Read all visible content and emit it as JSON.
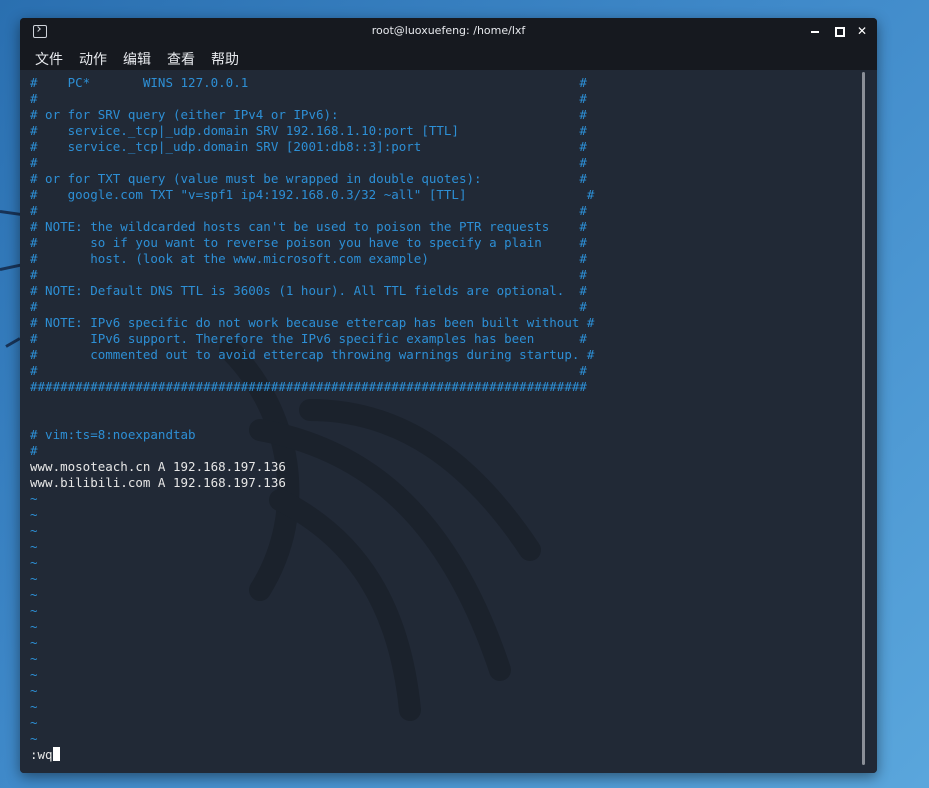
{
  "window": {
    "title": "root@luoxuefeng: /home/lxf",
    "close_glyph": "✕"
  },
  "menu": [
    "文件",
    "动作",
    "编辑",
    "查看",
    "帮助"
  ],
  "editor": {
    "lines": [
      {
        "text": "#    PC*       WINS 127.0.0.1                                            #",
        "style": "comment"
      },
      {
        "text": "#                                                                        #",
        "style": "comment"
      },
      {
        "text": "# or for SRV query (either IPv4 or IPv6):                                #",
        "style": "comment"
      },
      {
        "text": "#    service._tcp|_udp.domain SRV 192.168.1.10:port [TTL]                #",
        "style": "comment"
      },
      {
        "text": "#    service._tcp|_udp.domain SRV [2001:db8::3]:port                     #",
        "style": "comment"
      },
      {
        "text": "#                                                                        #",
        "style": "comment"
      },
      {
        "text": "# or for TXT query (value must be wrapped in double quotes):             #",
        "style": "comment"
      },
      {
        "text": "#    google.com TXT \"v=spf1 ip4:192.168.0.3/32 ~all\" [TTL]                #",
        "style": "comment"
      },
      {
        "text": "#                                                                        #",
        "style": "comment"
      },
      {
        "text": "# NOTE: the wildcarded hosts can't be used to poison the PTR requests    #",
        "style": "comment"
      },
      {
        "text": "#       so if you want to reverse poison you have to specify a plain     #",
        "style": "comment"
      },
      {
        "text": "#       host. (look at the www.microsoft.com example)                    #",
        "style": "comment"
      },
      {
        "text": "#                                                                        #",
        "style": "comment"
      },
      {
        "text": "# NOTE: Default DNS TTL is 3600s (1 hour). All TTL fields are optional.  #",
        "style": "comment"
      },
      {
        "text": "#                                                                        #",
        "style": "comment"
      },
      {
        "text": "# NOTE: IPv6 specific do not work because ettercap has been built without #",
        "style": "comment"
      },
      {
        "text": "#       IPv6 support. Therefore the IPv6 specific examples has been      #",
        "style": "comment"
      },
      {
        "text": "#       commented out to avoid ettercap throwing warnings during startup. #",
        "style": "comment"
      },
      {
        "text": "#                                                                        #",
        "style": "comment"
      },
      {
        "text": "##########################################################################",
        "style": "comment"
      },
      {
        "text": "",
        "style": "text"
      },
      {
        "text": "",
        "style": "text"
      },
      {
        "text": "# vim:ts=8:noexpandtab",
        "style": "comment"
      },
      {
        "text": "#",
        "style": "comment"
      },
      {
        "text": "www.mosoteach.cn A 192.168.197.136",
        "style": "text"
      },
      {
        "text": "www.bilibili.com A 192.168.197.136",
        "style": "text"
      },
      {
        "text": "~",
        "style": "tilde"
      },
      {
        "text": "~",
        "style": "tilde"
      },
      {
        "text": "~",
        "style": "tilde"
      },
      {
        "text": "~",
        "style": "tilde"
      },
      {
        "text": "~",
        "style": "tilde"
      },
      {
        "text": "~",
        "style": "tilde"
      },
      {
        "text": "~",
        "style": "tilde"
      },
      {
        "text": "~",
        "style": "tilde"
      },
      {
        "text": "~",
        "style": "tilde"
      },
      {
        "text": "~",
        "style": "tilde"
      },
      {
        "text": "~",
        "style": "tilde"
      },
      {
        "text": "~",
        "style": "tilde"
      },
      {
        "text": "~",
        "style": "tilde"
      },
      {
        "text": "~",
        "style": "tilde"
      },
      {
        "text": "~",
        "style": "tilde"
      },
      {
        "text": "~",
        "style": "tilde"
      }
    ],
    "command_line": ":wq"
  },
  "colors": {
    "comment": "#2d8fd5",
    "text": "#e6e6e6",
    "background": "#212936",
    "titlebar": "#16191f"
  }
}
